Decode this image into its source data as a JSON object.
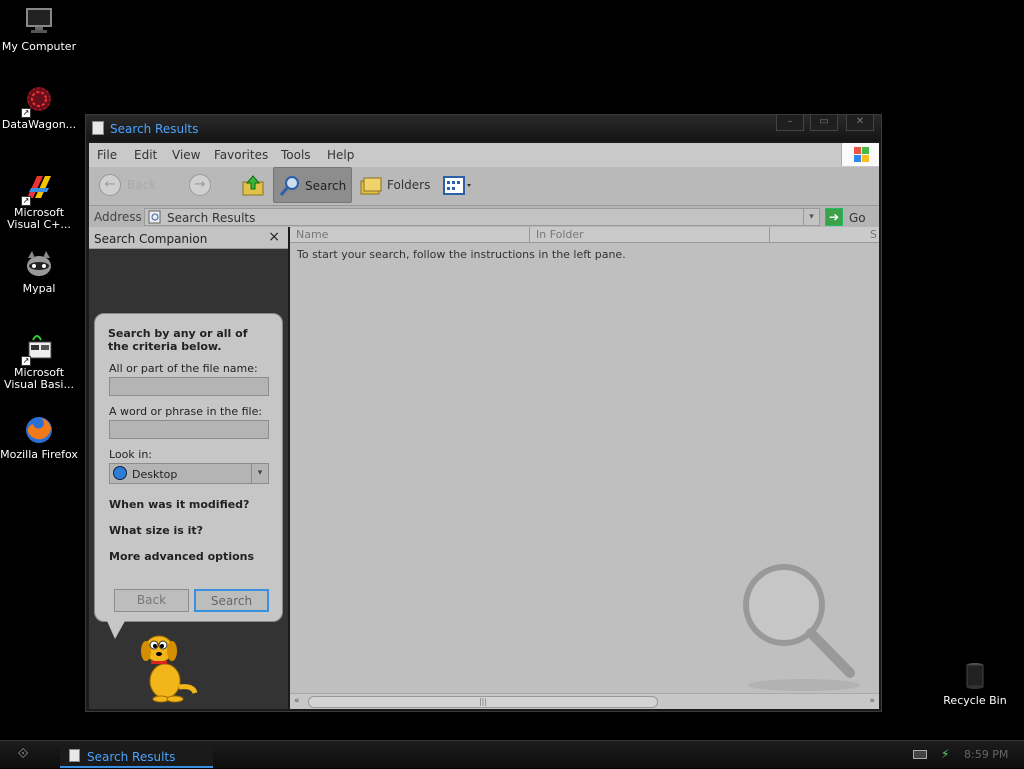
{
  "desktop": {
    "icons": [
      {
        "label": "My Computer"
      },
      {
        "label": "DataWagon..."
      },
      {
        "label": "Microsoft Visual C+..."
      },
      {
        "label": "Mypal"
      },
      {
        "label": "Microsoft Visual Basi..."
      },
      {
        "label": "Mozilla Firefox"
      },
      {
        "label": "Recycle Bin"
      }
    ]
  },
  "window": {
    "title": "Search Results",
    "menu": [
      "File",
      "Edit",
      "View",
      "Favorites",
      "Tools",
      "Help"
    ],
    "toolbar": {
      "back": "Back",
      "search": "Search",
      "folders": "Folders"
    },
    "address": {
      "label": "Address",
      "value": "Search Results",
      "go": "Go"
    },
    "companion": {
      "title": "Search Companion",
      "close": "×",
      "intro": "Search by any or all of the criteria below.",
      "filename_label": "All or part of the file name:",
      "filename_value": "",
      "phrase_label": "A word or phrase in the file:",
      "phrase_value": "",
      "lookin_label": "Look in:",
      "lookin_value": "Desktop",
      "options": [
        "When was it modified?",
        "What size is it?",
        "More advanced options"
      ],
      "back_button": "Back",
      "search_button": "Search"
    },
    "results": {
      "columns": [
        "Name",
        "In Folder",
        "S"
      ],
      "message": "To start your search, follow the instructions in the left pane."
    }
  },
  "taskbar": {
    "task": "Search Results",
    "clock": "8:59 PM"
  },
  "colors": {
    "title_text": "#4aa3ff",
    "desktop_bg": "#000000",
    "window_chrome": "#c9c9c9"
  }
}
